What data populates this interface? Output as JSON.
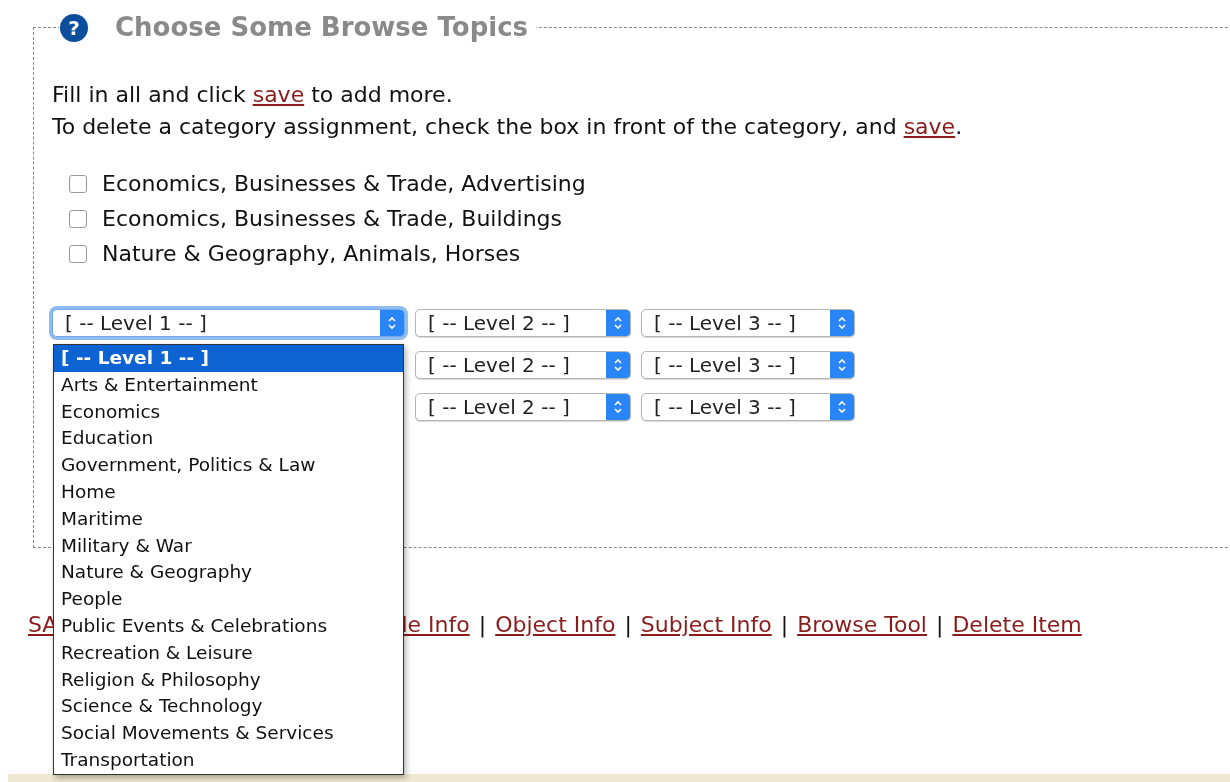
{
  "section": {
    "help_mark": "?",
    "title": "Choose Some Browse Topics",
    "instructions": [
      {
        "before": "Fill in all and click",
        "link": "save",
        "after": "to add more."
      },
      {
        "before": "To delete a category assignment, check the box in front of the category, and",
        "link": "save",
        "after": "."
      }
    ]
  },
  "assignments": [
    {
      "label": "Economics, Businesses & Trade, Advertising",
      "checked": false
    },
    {
      "label": "Economics, Businesses & Trade, Buildings",
      "checked": false
    },
    {
      "label": "Nature & Geography, Animals, Horses",
      "checked": false
    }
  ],
  "selector_rows": [
    {
      "level_1": "[ -- Level 1 -- ]",
      "level_2": "[ -- Level 2 -- ]",
      "level_3": "[ -- Level 3 -- ]",
      "focused": true
    },
    {
      "level_2": "[ -- Level 2 -- ]",
      "level_3": "[ -- Level 3 -- ]"
    },
    {
      "level_2": "[ -- Level 2 -- ]",
      "level_3": "[ -- Level 3 -- ]"
    }
  ],
  "dropdown": {
    "options": [
      {
        "label": "[ -- Level 1 -- ]",
        "selected": true
      },
      {
        "label": "Arts & Entertainment",
        "selected": false
      },
      {
        "label": "Economics",
        "selected": false
      },
      {
        "label": "Education",
        "selected": false
      },
      {
        "label": "Government, Politics & Law",
        "selected": false
      },
      {
        "label": "Home",
        "selected": false
      },
      {
        "label": "Maritime",
        "selected": false
      },
      {
        "label": "Military & War",
        "selected": false
      },
      {
        "label": "Nature & Geography",
        "selected": false
      },
      {
        "label": "People",
        "selected": false
      },
      {
        "label": "Public Events & Celebrations",
        "selected": false
      },
      {
        "label": "Recreation & Leisure",
        "selected": false
      },
      {
        "label": "Religion & Philosophy",
        "selected": false
      },
      {
        "label": "Science & Technology",
        "selected": false
      },
      {
        "label": "Social Movements & Services",
        "selected": false
      },
      {
        "label": "Transportation",
        "selected": false
      }
    ]
  },
  "footer_links": [
    {
      "label": "SA"
    },
    {
      "label": "le Info",
      "separator": "|"
    },
    {
      "label": "Object Info",
      "separator": "|"
    },
    {
      "label": "Subject Info",
      "separator": "|"
    },
    {
      "label": "Browse Tool",
      "separator": "|"
    },
    {
      "label": "Delete Item"
    }
  ]
}
